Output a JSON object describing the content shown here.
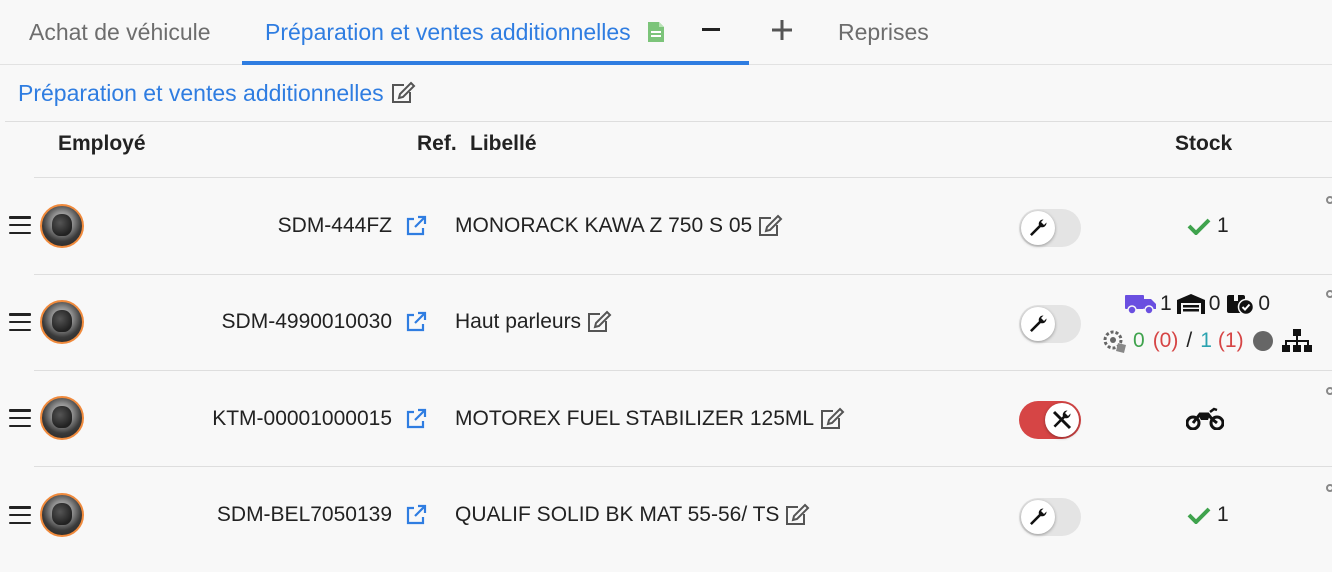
{
  "tabs": [
    {
      "label": "Achat de véhicule",
      "active": false
    },
    {
      "label": "Préparation et ventes additionnelles",
      "active": true
    },
    {
      "label": "Reprises",
      "active": false
    }
  ],
  "section_title": "Préparation et ventes additionnelles",
  "table": {
    "headers": {
      "employee": "Employé",
      "ref": "Ref.",
      "label": "Libellé",
      "stock": "Stock"
    },
    "rows": [
      {
        "ref": "SDM-444FZ",
        "label": "MONORACK KAWA Z 750 S 05",
        "workshop_toggle": false,
        "stock_type": "check",
        "stock_value": "1"
      },
      {
        "ref": "SDM-4990010030",
        "label": "Haut parleurs",
        "workshop_toggle": false,
        "stock_type": "detail",
        "stock": {
          "incoming": "1",
          "warehouse": "0",
          "reserved": "0",
          "available": "0",
          "available_paren": "(0)",
          "separator": "/",
          "ordered": "1",
          "ordered_paren": "(1)"
        }
      },
      {
        "ref": "KTM-00001000015",
        "label": "MOTOREX FUEL STABILIZER 125ML",
        "workshop_toggle": true,
        "stock_type": "vehicle"
      },
      {
        "ref": "SDM-BEL7050139",
        "label": "QUALIF SOLID BK MAT 55-56/ TS",
        "workshop_toggle": false,
        "stock_type": "check",
        "stock_value": "1"
      }
    ]
  },
  "colors": {
    "accent": "#2f7de1",
    "check": "#3fa34d",
    "truck": "#6a4fe0",
    "toggle_on": "#d64545",
    "red_value": "#d64545",
    "teal_value": "#2ba3b0"
  },
  "icons": [
    "file-sheet-icon",
    "minus-icon",
    "plus-icon",
    "edit-icon",
    "drag-handle-icon",
    "external-link-icon",
    "wrench-icon",
    "wrench-crossed-icon",
    "check-icon",
    "truck-icon",
    "warehouse-icon",
    "box-check-icon",
    "gear-tag-icon",
    "circle-icon",
    "hierarchy-icon",
    "motorcycle-icon"
  ]
}
